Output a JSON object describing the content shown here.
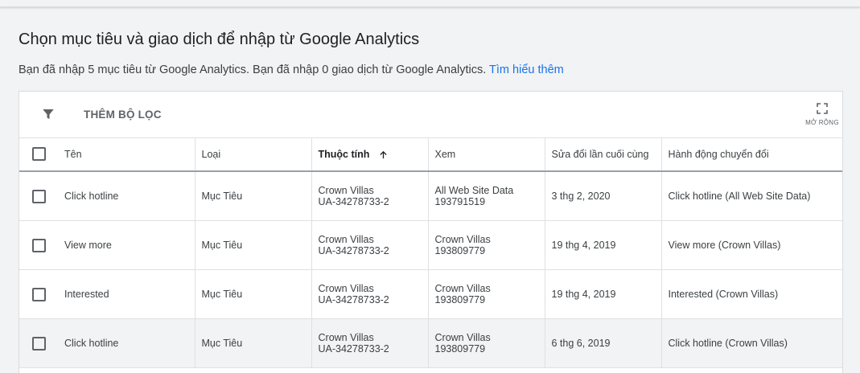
{
  "page": {
    "title": "Chọn mục tiêu và giao dịch để nhập từ Google Analytics",
    "subtitle": "Bạn đã nhập 5 mục tiêu từ Google Analytics. Bạn đã nhập 0 giao dịch từ Google Analytics.",
    "learn_more": "Tìm hiểu thêm"
  },
  "toolbar": {
    "filter_label": "THÊM BỘ LỌC",
    "filter_icon": "filter-icon",
    "expand_label": "MỞ RỘNG",
    "expand_icon": "fullscreen-icon"
  },
  "table": {
    "columns": [
      "Tên",
      "Loại",
      "Thuộc tính",
      "Xem",
      "Sửa đổi lần cuối cùng",
      "Hành động chuyển đổi"
    ],
    "sorted_column": "Thuộc tính",
    "rows": [
      {
        "name": "Click hotline",
        "type": "Mục Tiêu",
        "property": "Crown Villas",
        "property_id": "UA-34278733-2",
        "view": "All Web Site Data",
        "view_id": "193791519",
        "modified": "3 thg 2, 2020",
        "action": "Click hotline (All Web Site Data)"
      },
      {
        "name": "View more",
        "type": "Mục Tiêu",
        "property": "Crown Villas",
        "property_id": "UA-34278733-2",
        "view": "Crown Villas",
        "view_id": "193809779",
        "modified": "19 thg 4, 2019",
        "action": "View more (Crown Villas)"
      },
      {
        "name": "Interested",
        "type": "Mục Tiêu",
        "property": "Crown Villas",
        "property_id": "UA-34278733-2",
        "view": "Crown Villas",
        "view_id": "193809779",
        "modified": "19 thg 4, 2019",
        "action": "Interested (Crown Villas)"
      },
      {
        "name": "Click hotline",
        "type": "Mục Tiêu",
        "property": "Crown Villas",
        "property_id": "UA-34278733-2",
        "view": "Crown Villas",
        "view_id": "193809779",
        "modified": "6 thg 6, 2019",
        "action": "Click hotline (Crown Villas)"
      }
    ]
  }
}
